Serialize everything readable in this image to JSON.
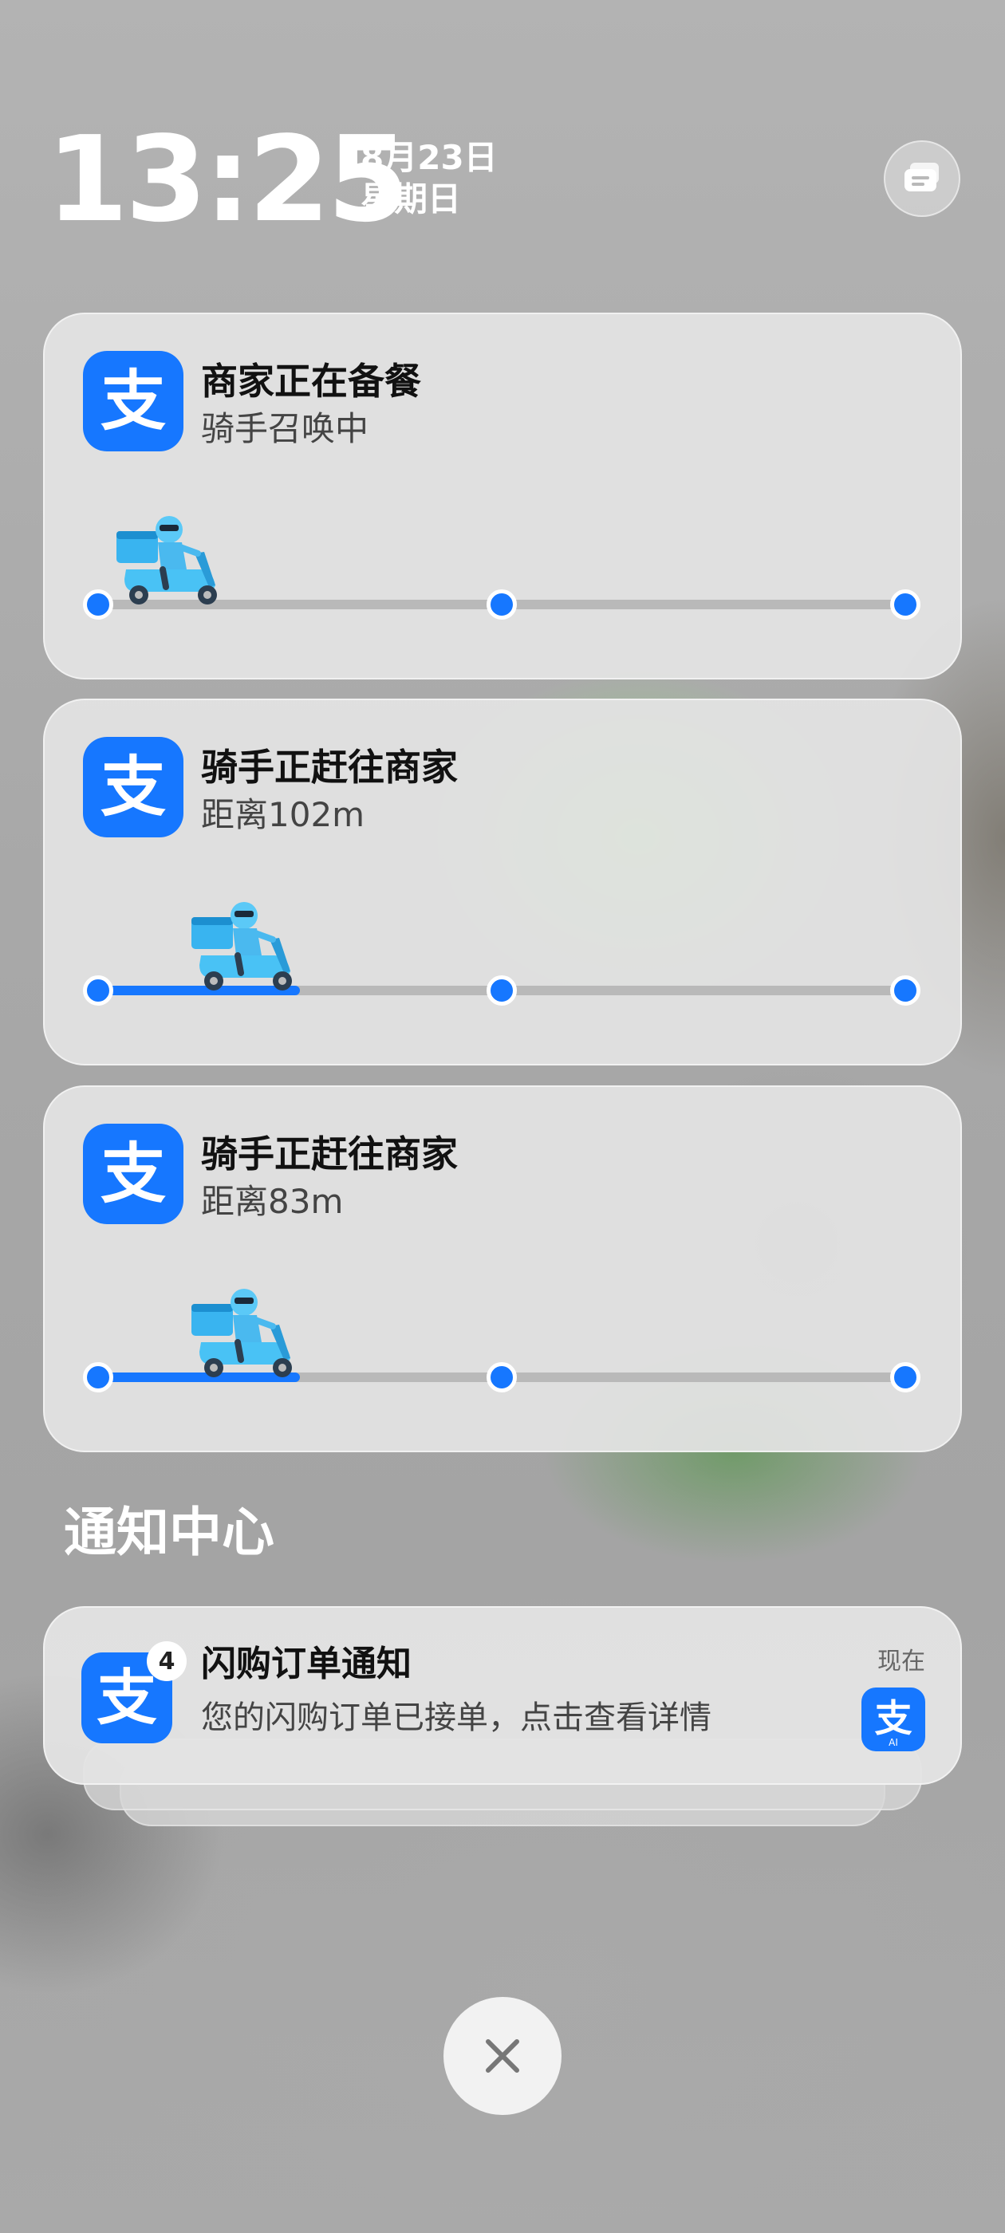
{
  "lockscreen": {
    "time": "13:25",
    "date": "8月23日",
    "weekday": "星期日"
  },
  "corner_button": {
    "icon": "notification-stack-icon"
  },
  "live_activities": [
    {
      "app_icon": "alipay-icon",
      "title": "商家正在备餐",
      "subtitle": "骑手召唤中",
      "progress": 0
    },
    {
      "app_icon": "alipay-icon",
      "title": "骑手正赶往商家",
      "subtitle": "距离102m",
      "progress": 0.25
    },
    {
      "app_icon": "alipay-icon",
      "title": "骑手正赶往商家",
      "subtitle": "距离83m",
      "progress": 0.25
    }
  ],
  "notification_center": {
    "heading": "通知中心",
    "notifications": [
      {
        "app_icon": "alipay-icon",
        "badge": "4",
        "title": "闪购订单通知",
        "body": "您的闪购订单已接单，点击查看详情",
        "time": "现在",
        "thumb_label": "AI"
      }
    ]
  },
  "close_button": {
    "icon": "close-icon"
  },
  "colors": {
    "accent": "#1677ff",
    "track": "#b9b9b9",
    "card": "#e4e4e4"
  }
}
